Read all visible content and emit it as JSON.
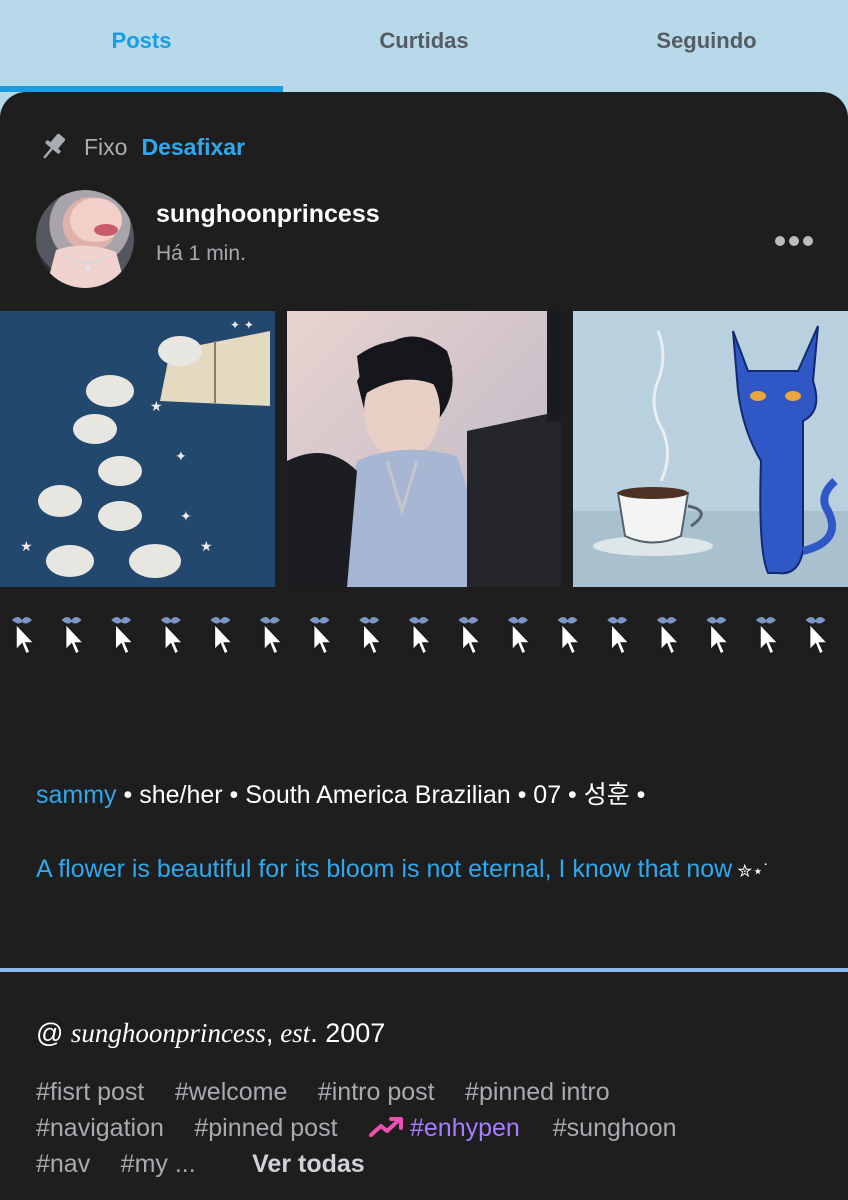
{
  "tabs": [
    {
      "label": "Posts",
      "active": true
    },
    {
      "label": "Curtidas",
      "active": false
    },
    {
      "label": "Seguindo",
      "active": false
    }
  ],
  "pinned": {
    "label": "Fixo",
    "unpin_label": "Desafixar",
    "icon": "pin-icon"
  },
  "post": {
    "username": "sunghoonprincess",
    "timestamp": "Há 1 min.",
    "more_icon": "more-options-icon",
    "images": [
      {
        "name": "bunnies-illustration"
      },
      {
        "name": "idol-photo"
      },
      {
        "name": "blue-cat-coffee-painting"
      }
    ],
    "decoration": "cursor-pointer-icon",
    "bio": {
      "name": "sammy",
      "rest": " • she/her • South America Brazilian • 07 • 성훈 •"
    },
    "quote": {
      "text": "A flower is beautiful for its bloom is not eternal, I know that now",
      "sparkle": " ✮⋆˙"
    },
    "est": {
      "prefix": "@ ",
      "handle": "sunghoonprincess",
      "comma": ",",
      "est": " est",
      "year": ". 2007"
    },
    "tags": [
      [
        "#fisrt post",
        "#welcome",
        "#intro post",
        "#pinned intro"
      ],
      [
        "#navigation",
        "#pinned post",
        "#enhypen",
        "#sunghoon"
      ],
      [
        "#nav",
        "#my ..."
      ]
    ],
    "trending_tag": "#enhypen",
    "see_all_label": "Ver todas"
  },
  "colors": {
    "accent": "#1a9be6",
    "background_top": "#b7d9ea",
    "card": "#1e1e1f",
    "separator": "#8bb9ee",
    "trending": "#a77dff"
  }
}
